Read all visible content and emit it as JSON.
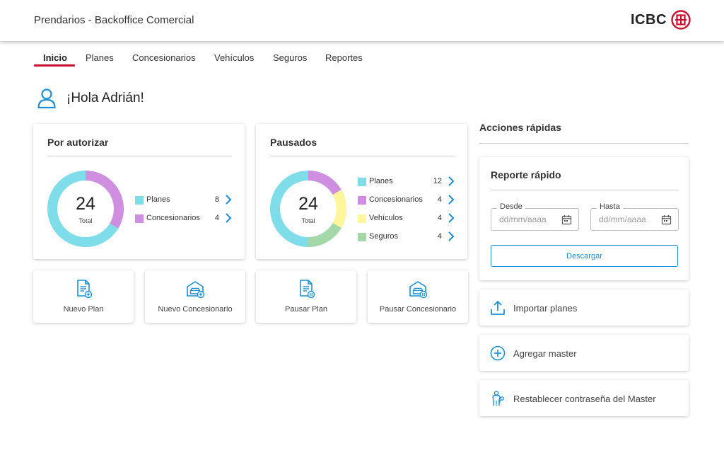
{
  "header": {
    "title": "Prendarios - Backoffice Comercial",
    "brand": "ICBC",
    "brand_color": "#c8102e"
  },
  "nav": {
    "items": [
      {
        "label": "Inicio",
        "active": true
      },
      {
        "label": "Planes",
        "active": false
      },
      {
        "label": "Concesionarios",
        "active": false
      },
      {
        "label": "Vehículos",
        "active": false
      },
      {
        "label": "Seguros",
        "active": false
      },
      {
        "label": "Reportes",
        "active": false
      }
    ]
  },
  "greeting": {
    "text": "¡Hola Adrián!",
    "icon": "user-icon"
  },
  "por_autorizar": {
    "title": "Por autorizar",
    "total": "24",
    "total_label": "Total",
    "items": [
      {
        "label": "Planes",
        "count": "8",
        "color": "#7fdde9"
      },
      {
        "label": "Concesionarios",
        "count": "4",
        "color": "#d08ee0"
      }
    ]
  },
  "pausados": {
    "title": "Pausados",
    "total": "24",
    "total_label": "Total",
    "items": [
      {
        "label": "Planes",
        "count": "12",
        "color": "#7fdde9"
      },
      {
        "label": "Concesionarios",
        "count": "4",
        "color": "#d08ee0"
      },
      {
        "label": "Vehículos",
        "count": "4",
        "color": "#fff59a"
      },
      {
        "label": "Seguros",
        "count": "4",
        "color": "#a5d8a8"
      }
    ]
  },
  "tiles": [
    {
      "label": "Nuevo Plan",
      "icon": "document-add-icon"
    },
    {
      "label": "Nuevo Concesionario",
      "icon": "garage-car-add-icon"
    },
    {
      "label": "Pausar Plan",
      "icon": "document-pause-icon"
    },
    {
      "label": "Pausar Concesionario",
      "icon": "garage-car-pause-icon"
    }
  ],
  "quick_actions": {
    "title": "Acciones rápidas",
    "report": {
      "title": "Reporte rápido",
      "from_label": "Desde",
      "to_label": "Hasta",
      "date_placeholder": "dd/mm/aaaa",
      "download_label": "Descargar"
    },
    "actions": [
      {
        "label": "Importar planes",
        "icon": "upload-icon"
      },
      {
        "label": "Agregar master",
        "icon": "plus-circle-icon"
      },
      {
        "label": "Restablecer contraseña del Master",
        "icon": "person-key-icon"
      }
    ]
  },
  "colors": {
    "accent": "#1b8fd6",
    "active_underline": "#c8102e"
  }
}
